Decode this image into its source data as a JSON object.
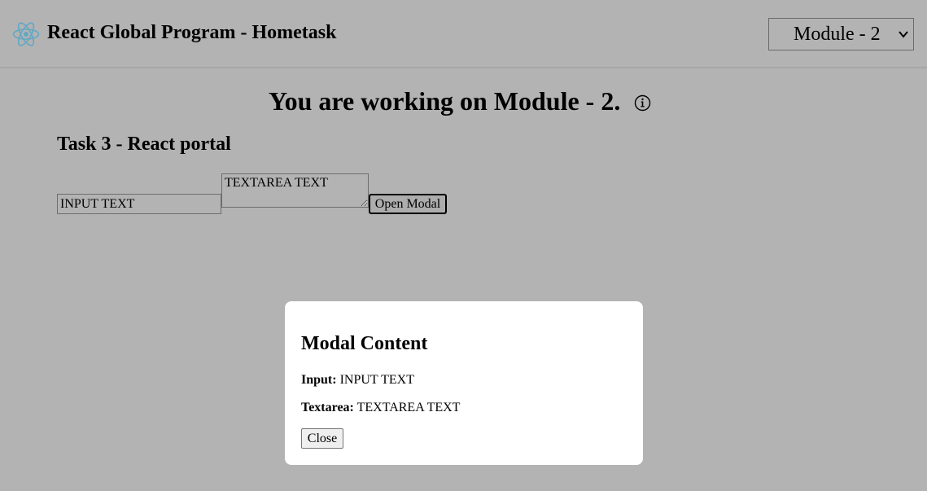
{
  "header": {
    "title": "React Global Program - Hometask",
    "logo_icon": "react-logo-icon",
    "module_select": {
      "value": "Module - 2"
    }
  },
  "main": {
    "heading": "You are working on Module - 2.",
    "info_icon": "info-icon",
    "task_title": "Task 3 - React portal",
    "input_value": "INPUT TEXT",
    "textarea_value": "TEXTAREA TEXT",
    "open_modal_label": "Open Modal"
  },
  "modal": {
    "title": "Modal Content",
    "input_label": "Input:",
    "input_value": "INPUT TEXT",
    "textarea_label": "Textarea:",
    "textarea_value": "TEXTAREA TEXT",
    "close_label": "Close"
  },
  "colors": {
    "overlay_background": "#b3b3b3",
    "modal_background": "#ffffff",
    "react_logo": "#61a8c4"
  }
}
